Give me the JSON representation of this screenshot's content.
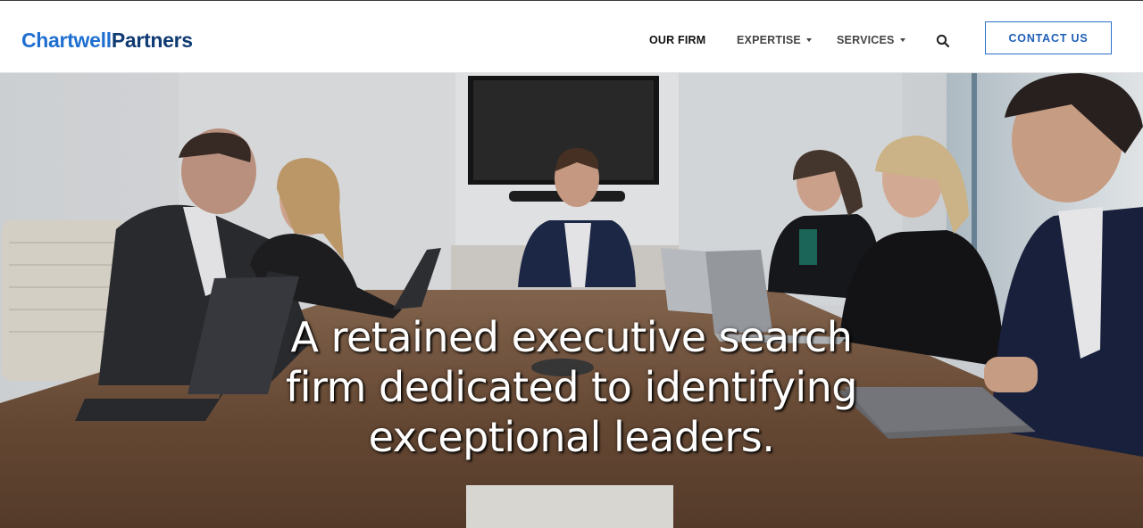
{
  "header": {
    "logo_part1": "Chartwell",
    "logo_part2": "Partners",
    "nav": [
      {
        "label": "OUR FIRM"
      },
      {
        "label": "EXPERTISE"
      },
      {
        "label": "SERVICES"
      }
    ],
    "search_icon": "search-icon",
    "contact_label": "CONTACT US"
  },
  "hero": {
    "headline": "A retained executive search firm dedicated to identifying exceptional leaders."
  },
  "colors": {
    "brand_blue": "#1f6fd1",
    "brand_navy": "#0f3a73",
    "button_border": "#2a6fc9"
  }
}
